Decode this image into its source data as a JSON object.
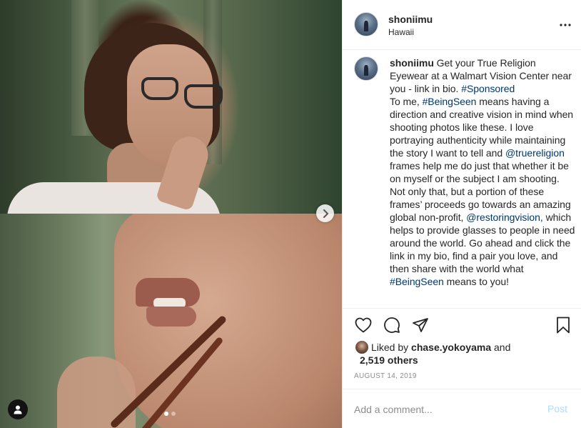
{
  "post": {
    "username": "shoniimu",
    "location": "Hawaii",
    "caption": {
      "username": "shoniimu",
      "segments": [
        {
          "text": " Get your True Religion Eyewear at a Walmart Vision Center near you - link in bio. ",
          "link": false
        },
        {
          "text": "#Sponsored",
          "link": true
        },
        {
          "text": " To me, ",
          "link": false
        },
        {
          "text": "#BeingSeen",
          "link": true
        },
        {
          "text": " means having a direction and creative vision in mind when shooting photos like these. I love portraying authenticity while maintaining the story I want to tell and ",
          "link": false
        },
        {
          "text": "@truereligion",
          "link": true
        },
        {
          "text": " frames help me do just that whether it be on myself or the subject I am shooting. Not only that, but a portion of these frames’ proceeds go towards an amazing global non-profit, ",
          "link": false
        },
        {
          "text": "@restoringvision,",
          "link": true
        },
        {
          "text": " which helps to provide glasses to people in need around the world. Go ahead and click the link in my bio, find a pair you love, and then share with the world what ",
          "link": false
        },
        {
          "text": "#BeingSeen",
          "link": true
        },
        {
          "text": " means to you!",
          "link": false
        }
      ]
    },
    "likes": {
      "prefix": "Liked by ",
      "liked_by": "chase.yokoyama",
      "and": " and",
      "others": "2,519 others"
    },
    "date": "AUGUST 14, 2019",
    "comment": {
      "placeholder": "Add a comment...",
      "value": "",
      "post_label": "Post"
    },
    "carousel": {
      "total": 2,
      "current": 1
    }
  },
  "icons": {
    "more": "more-horizontal-icon",
    "like": "heart-icon",
    "comment": "comment-icon",
    "share": "paper-plane-icon",
    "save": "bookmark-icon",
    "next": "chevron-right-icon",
    "tag": "user-tag-icon"
  },
  "colors": {
    "link": "#00376b",
    "muted": "#8e8e8e",
    "post_disabled": "#b3dbff",
    "border": "#efefef"
  }
}
